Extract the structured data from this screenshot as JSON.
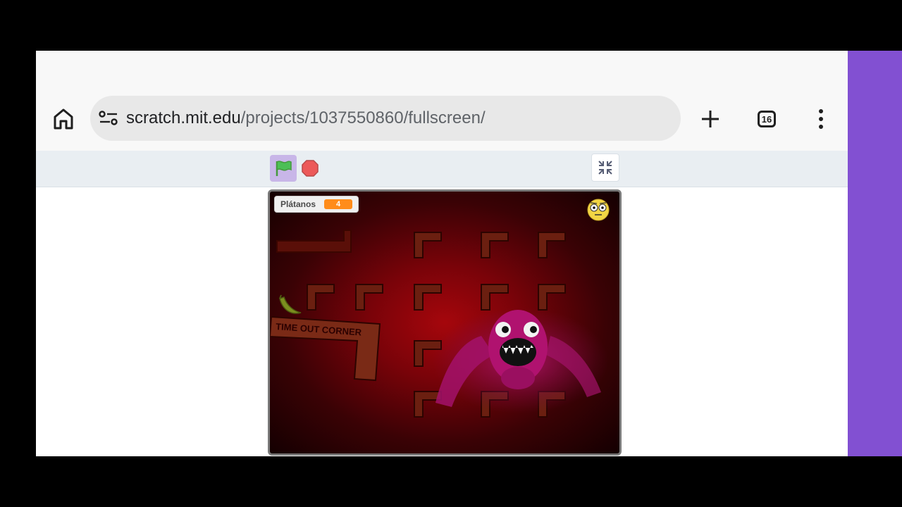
{
  "browser": {
    "url_host": "scratch.mit.edu",
    "url_path": "/projects/1037550860/fullscreen/",
    "tab_count": "16"
  },
  "colors": {
    "side_accent": "#8250d2",
    "flag_green": "#4cbf56",
    "stop_red": "#ec5959",
    "monitor_orange": "#ff8c1a"
  },
  "icons": [
    "home-icon",
    "site-settings-icon",
    "plus-icon",
    "tabs-icon",
    "more-vert-icon",
    "green-flag-icon",
    "stop-icon",
    "exit-fullscreen-icon"
  ],
  "stage": {
    "monitor_label": "Plátanos",
    "monitor_value": "4",
    "sign_text": "TIME OUT CORNER"
  }
}
